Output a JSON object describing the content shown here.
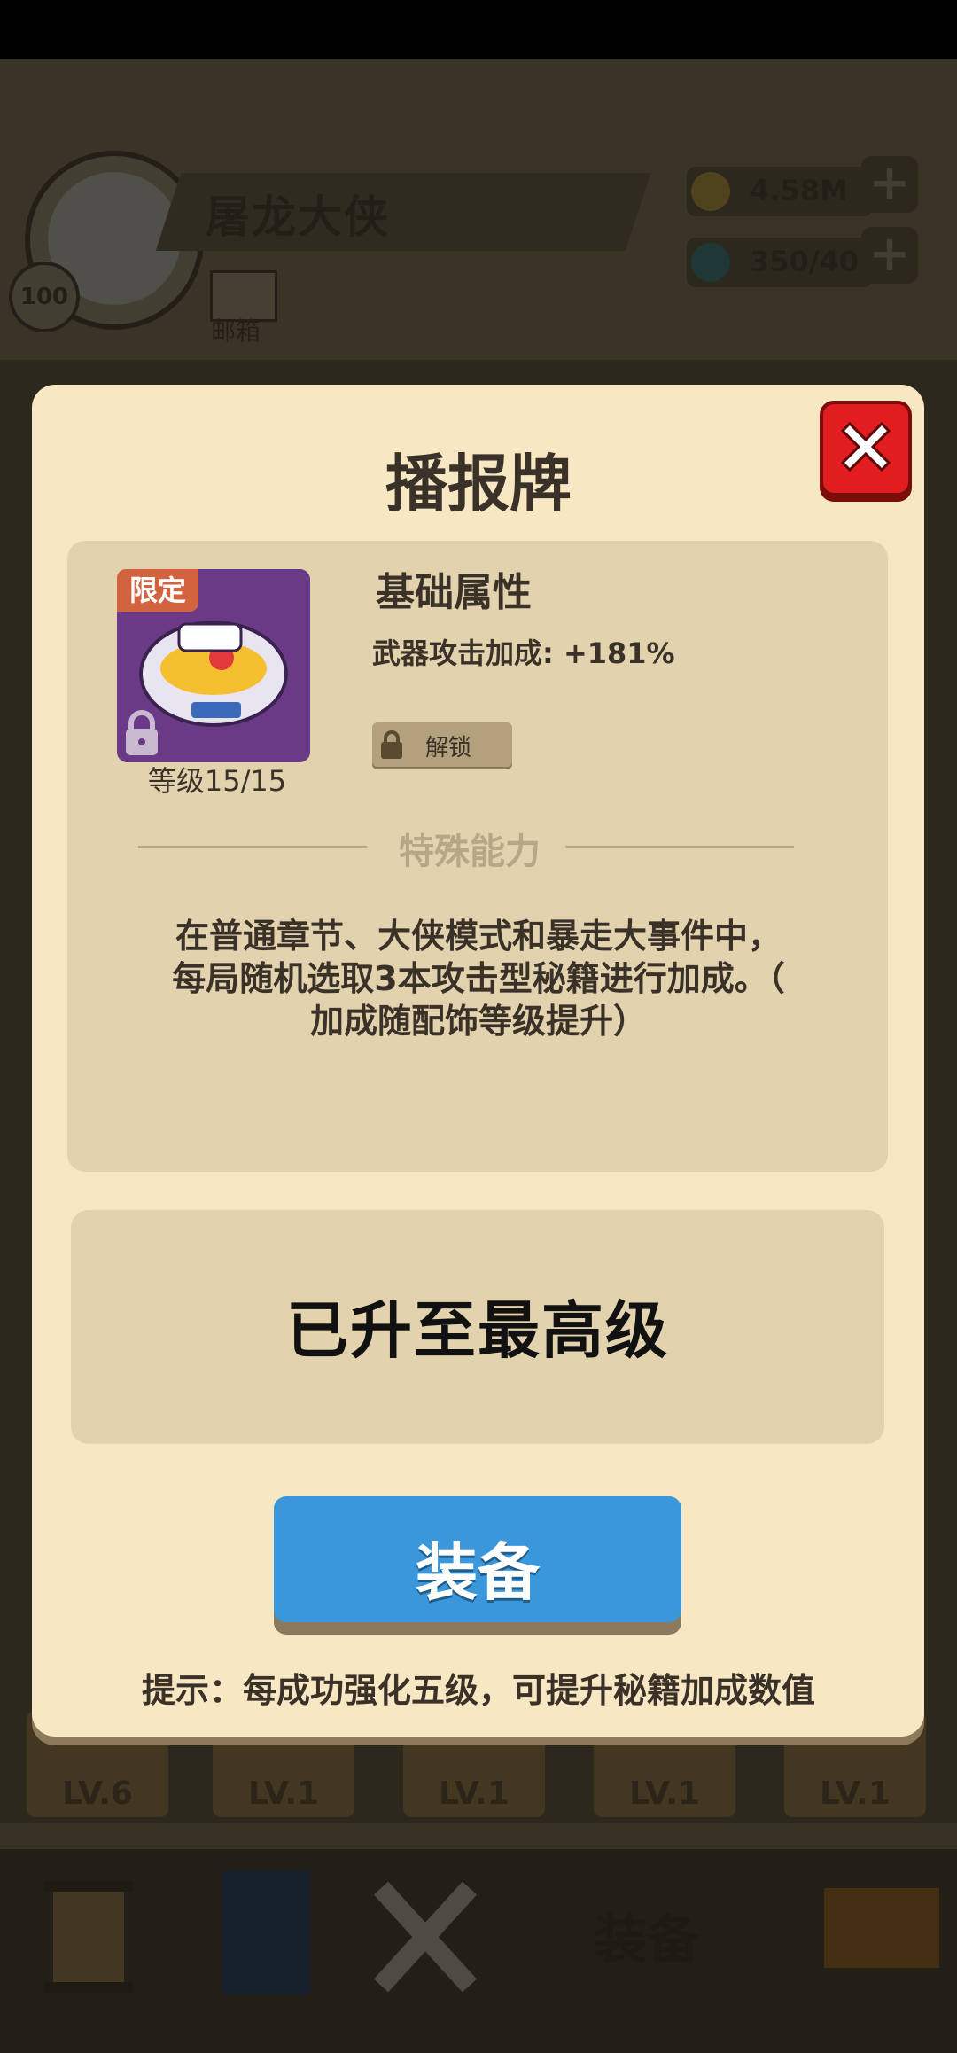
{
  "background": {
    "player": {
      "name": "屠龙大侠",
      "level": "100",
      "mail_label": "邮箱"
    },
    "resources": {
      "gold": "4.58M",
      "gems": "350/40"
    },
    "items": [
      "LV.6",
      "LV.1",
      "LV.1",
      "LV.1",
      "LV.1"
    ],
    "nav": {
      "active_label": "装备"
    }
  },
  "modal": {
    "title": "播报牌",
    "item": {
      "tag": "限定",
      "level_text": "等级15/15"
    },
    "base_stats": {
      "heading": "基础属性",
      "line": "武器攻击加成: +181%",
      "unlock_label": "解锁"
    },
    "special": {
      "heading": "特殊能力",
      "lines": [
        "在普通章节、大侠模式和暴走大事件中，",
        "每局随机选取3本攻击型秘籍进行加成。（",
        "加成随配饰等级提升）"
      ]
    },
    "max_level_text": "已升至最高级",
    "equip_button": "装备",
    "tip": "提示：每成功强化五级，可提升秘籍加成数值"
  },
  "colors": {
    "modal_bg": "#f8e7c3",
    "panel_bg": "#e2d2ad",
    "equip_blue": "#3a97dc",
    "close_red": "#e11d1d",
    "tag_orange": "#d3623f"
  }
}
